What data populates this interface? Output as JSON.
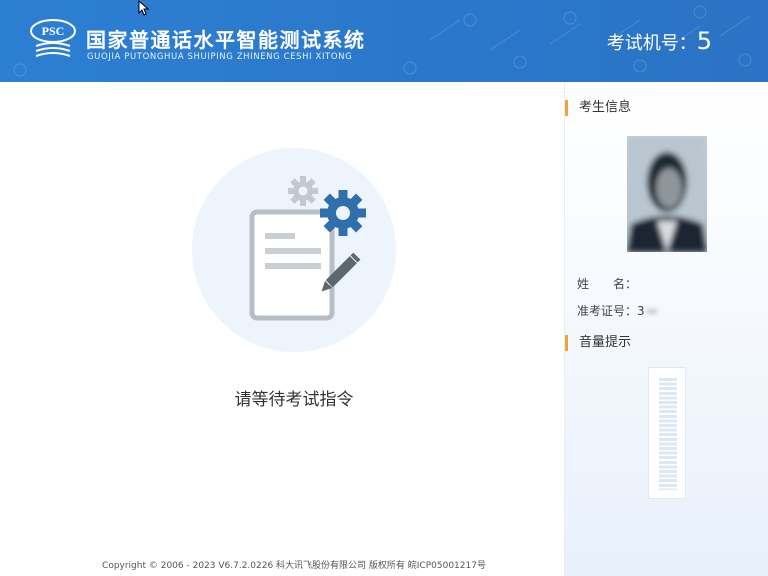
{
  "header": {
    "logo_text": "PSC",
    "title": "国家普通话水平智能测试系统",
    "subtitle": "GUOJIA PUTONGHUA SHUIPING ZHINENG CESHI XITONG",
    "machine_label": "考试机号：",
    "machine_number": "5"
  },
  "main": {
    "wait_message": "请等待考试指令",
    "copyright": "Copyright © 2006 - 2023 V6.7.2.0226 科大讯飞股份有限公司 版权所有 皖ICP05001217号"
  },
  "sidebar": {
    "candidate_title": "考生信息",
    "name_label": "姓　　名：",
    "name_value": "",
    "ticket_label": "准考证号：",
    "ticket_value": "3",
    "volume_title": "音量提示"
  },
  "colors": {
    "header_blue": "#2a78cc",
    "accent_orange": "#f0a23b",
    "icon_blue": "#2f6fab",
    "icon_gray": "#b8bec6"
  },
  "icons": [
    "psc-logo-icon",
    "document-icon",
    "gear-icon",
    "pencil-icon",
    "cursor-icon"
  ]
}
